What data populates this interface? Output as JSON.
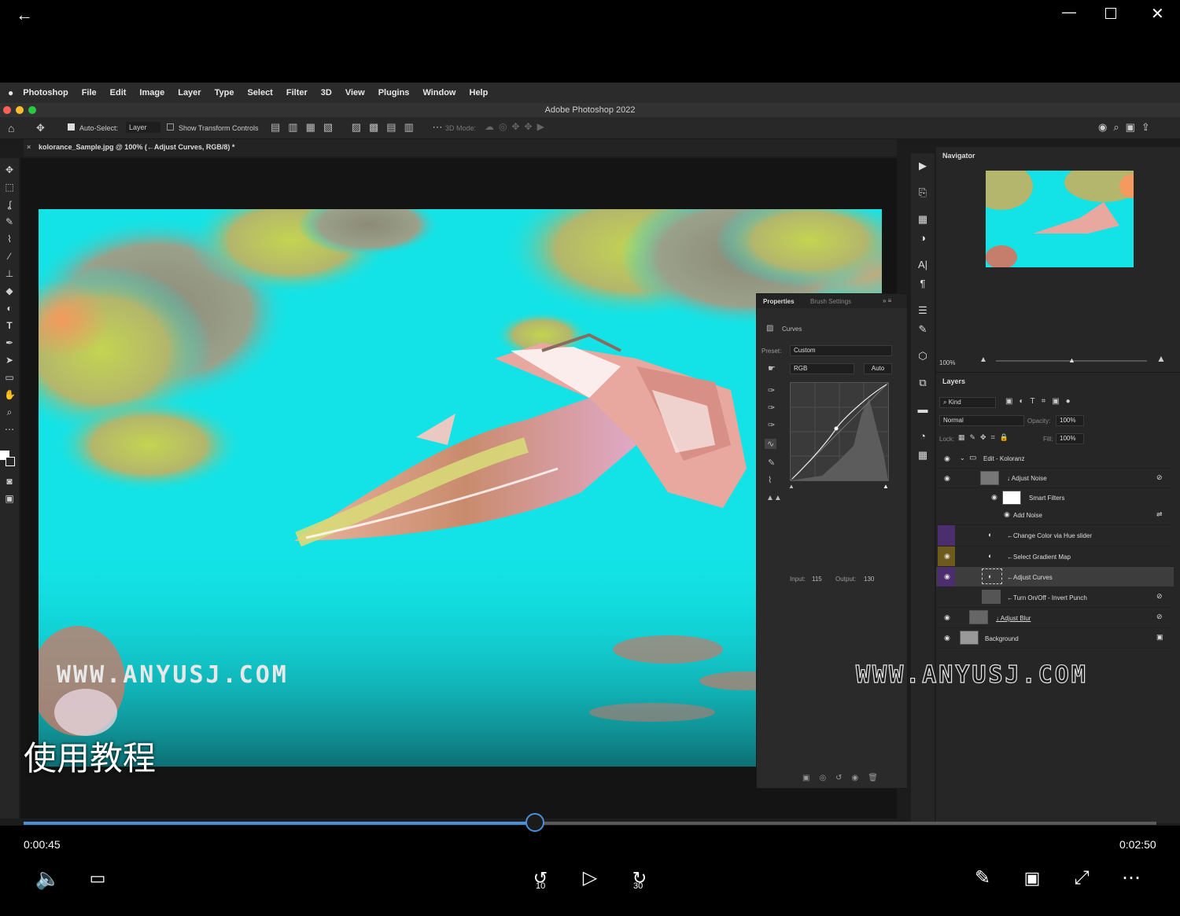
{
  "window": {
    "back_icon": "back-arrow-icon",
    "minimize_icon": "minimize-icon",
    "maximize_icon": "maximize-icon",
    "close_icon": "close-icon"
  },
  "mac_menu": {
    "apple": "",
    "items": [
      "Photoshop",
      "File",
      "Edit",
      "Image",
      "Layer",
      "Type",
      "Select",
      "Filter",
      "3D",
      "View",
      "Plugins",
      "Window",
      "Help"
    ]
  },
  "ps": {
    "app_title": "Adobe Photoshop 2022",
    "options": {
      "auto_select": "Auto-Select:",
      "layer": "Layer",
      "show_transform": "Show Transform Controls",
      "mode_3d": "3D Mode:"
    },
    "doc_tab": "kolorance_Sample.jpg @ 100% (←Adjust Curves, RGB/8) *",
    "navigator": {
      "title": "Navigator",
      "zoom": "100%"
    },
    "properties": {
      "tab1": "Properties",
      "tab2": "Brush Settings",
      "section": "Curves",
      "preset_label": "Preset:",
      "preset_value": "Custom",
      "channel": "RGB",
      "auto": "Auto",
      "input_label": "Input:",
      "input_value": "115",
      "output_label": "Output:",
      "output_value": "130"
    },
    "layers": {
      "title": "Layers",
      "kind": "Kind",
      "blend": "Normal",
      "opacity_label": "Opacity:",
      "opacity": "100%",
      "lock_label": "Lock:",
      "fill_label": "Fill:",
      "fill": "100%",
      "rows": [
        {
          "name": "Edit - Koloranz",
          "type": "group"
        },
        {
          "name": "↓ Adjust Noise",
          "type": "smart"
        },
        {
          "name": "Smart Filters",
          "type": "sub"
        },
        {
          "name": "Add Noise",
          "type": "sub2"
        },
        {
          "name": "←Change Color via Hue slider",
          "type": "adj"
        },
        {
          "name": "←Select Gradient Map",
          "type": "adj"
        },
        {
          "name": "←Adjust Curves",
          "type": "adj"
        },
        {
          "name": "←Turn On/Off - Invert Punch",
          "type": "adj"
        },
        {
          "name": "↓ Adjust Blur",
          "type": "smart"
        },
        {
          "name": "Background",
          "type": "bg"
        }
      ]
    }
  },
  "overlay": {
    "watermark_left": "WWW.ANYUSJ.COM",
    "watermark_right": "WWW.ANYUSJ.COM",
    "caption": "使用教程"
  },
  "controls": {
    "current_time": "0:00:45",
    "total_time": "0:02:50",
    "progress": 0.4514,
    "skip_back": "10",
    "skip_forward": "30"
  },
  "colors": {
    "accent": "#4a90d9",
    "sky": "#13e3e6",
    "cloud": "#d7e36a"
  }
}
